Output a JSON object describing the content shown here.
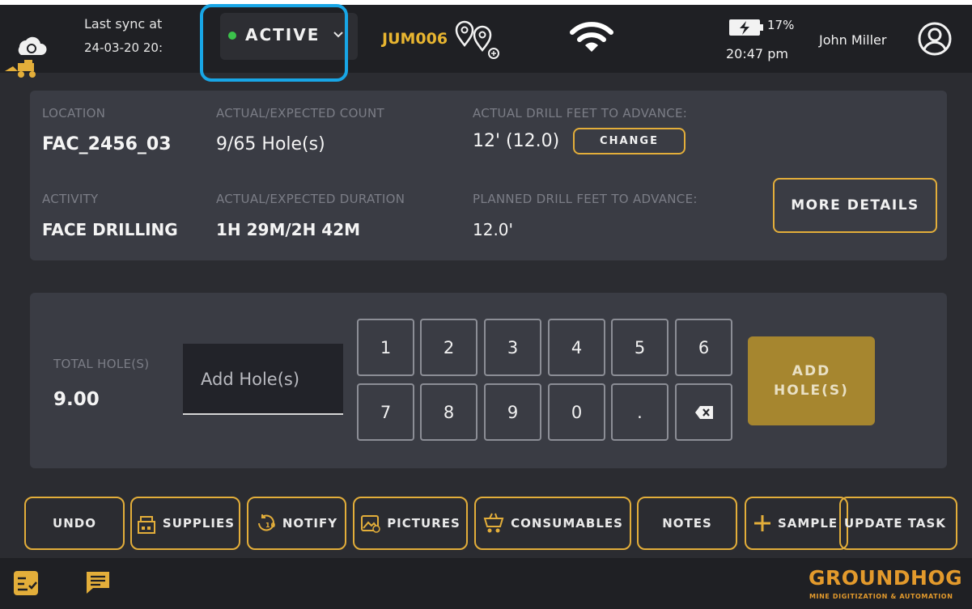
{
  "header": {
    "sync_line1": "Last sync at",
    "sync_line2": "24-03-20 20:",
    "status": "ACTIVE",
    "machine_id": "JUM006",
    "battery": "17%",
    "time": "20:47 pm",
    "user_name": "John Miller"
  },
  "info": {
    "location_label": "LOCATION",
    "location_value": "FAC_2456_03",
    "count_label": "ACTUAL/EXPECTED COUNT",
    "count_value": "9/65 Hole(s)",
    "drill_feet_label": "ACTUAL DRILL FEET TO ADVANCE:",
    "drill_feet_value": "12' (12.0)",
    "change_button": "CHANGE",
    "activity_label": "ACTIVITY",
    "activity_value": "FACE DRILLING",
    "duration_label": "ACTUAL/EXPECTED DURATION",
    "duration_value": "1H 29M/2H 42M",
    "planned_label": "PLANNED DRILL FEET TO ADVANCE:",
    "planned_value": "12.0'",
    "more_details_button": "MORE DETAILS"
  },
  "entry": {
    "total_label": "TOTAL HOLE(S)",
    "total_value": "9.00",
    "input_placeholder": "Add Hole(s)",
    "keypad": [
      "1",
      "2",
      "3",
      "4",
      "5",
      "6",
      "7",
      "8",
      "9",
      "0",
      "."
    ],
    "add_button_line1": "ADD",
    "add_button_line2": "HOLE(S)"
  },
  "actions": {
    "undo": "UNDO",
    "supplies": "SUPPLIES",
    "notify": "NOTIFY",
    "pictures": "PICTURES",
    "consumables": "CONSUMABLES",
    "notes": "NOTES",
    "sample": "SAMPLE",
    "update_task": "UPDATE TASK"
  },
  "footer": {
    "logo": "GROUNDHOG",
    "tagline": "MINE DIGITIZATION & AUTOMATION"
  },
  "colors": {
    "accent": "#e3ae3a",
    "highlight_outline": "#18a6e6",
    "status_green": "#3bc24b",
    "background": "#2b2c31",
    "panel": "#3a3c44"
  },
  "icons": [
    "cloud-sync-icon",
    "loader-machine-icon",
    "chevron-down-icon",
    "location-pins-icon",
    "wifi-icon",
    "battery-charging-icon",
    "user-avatar-icon",
    "backspace-icon",
    "supplies-icon",
    "notify-icon",
    "pictures-icon",
    "consumables-icon",
    "plus-icon",
    "tasks-icon",
    "chat-icon"
  ]
}
